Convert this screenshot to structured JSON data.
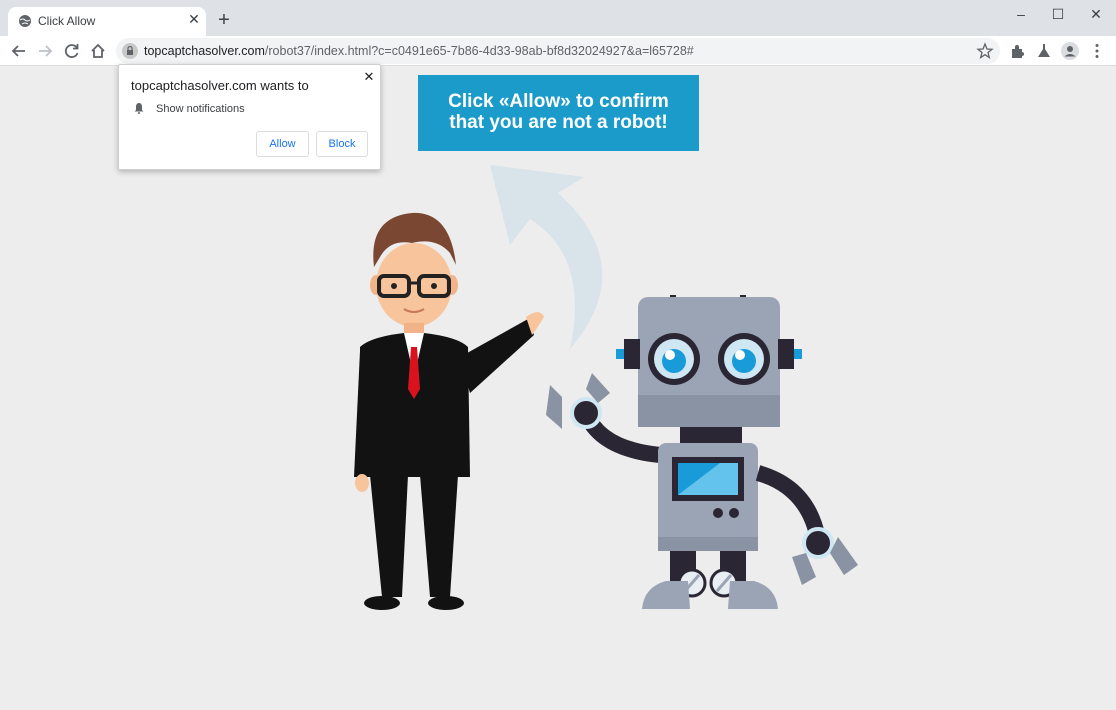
{
  "tab": {
    "title": "Click Allow",
    "favicon": "globe-icon",
    "close_icon": "close-icon"
  },
  "new_tab_label": "+",
  "window_controls": {
    "minimize": "minimize-icon",
    "maximize": "maximize-icon",
    "close": "close-icon"
  },
  "toolbar": {
    "url_domain": "topcaptchasolver.com",
    "url_path": "/robot37/index.html?c=c0491e65-7b86-4d33-98ab-bf8d32024927&a=l65728#"
  },
  "popup": {
    "title": "topcaptchasolver.com wants to",
    "permission": "Show notifications",
    "allow_label": "Allow",
    "block_label": "Block",
    "close_label": "✕"
  },
  "banner": {
    "line1": "Click «Allow» to confirm",
    "line2": "that you are not a robot!"
  },
  "colors": {
    "banner": "#1a9bc9",
    "page_background": "#ededed",
    "link_blue": "#1a73e8"
  }
}
